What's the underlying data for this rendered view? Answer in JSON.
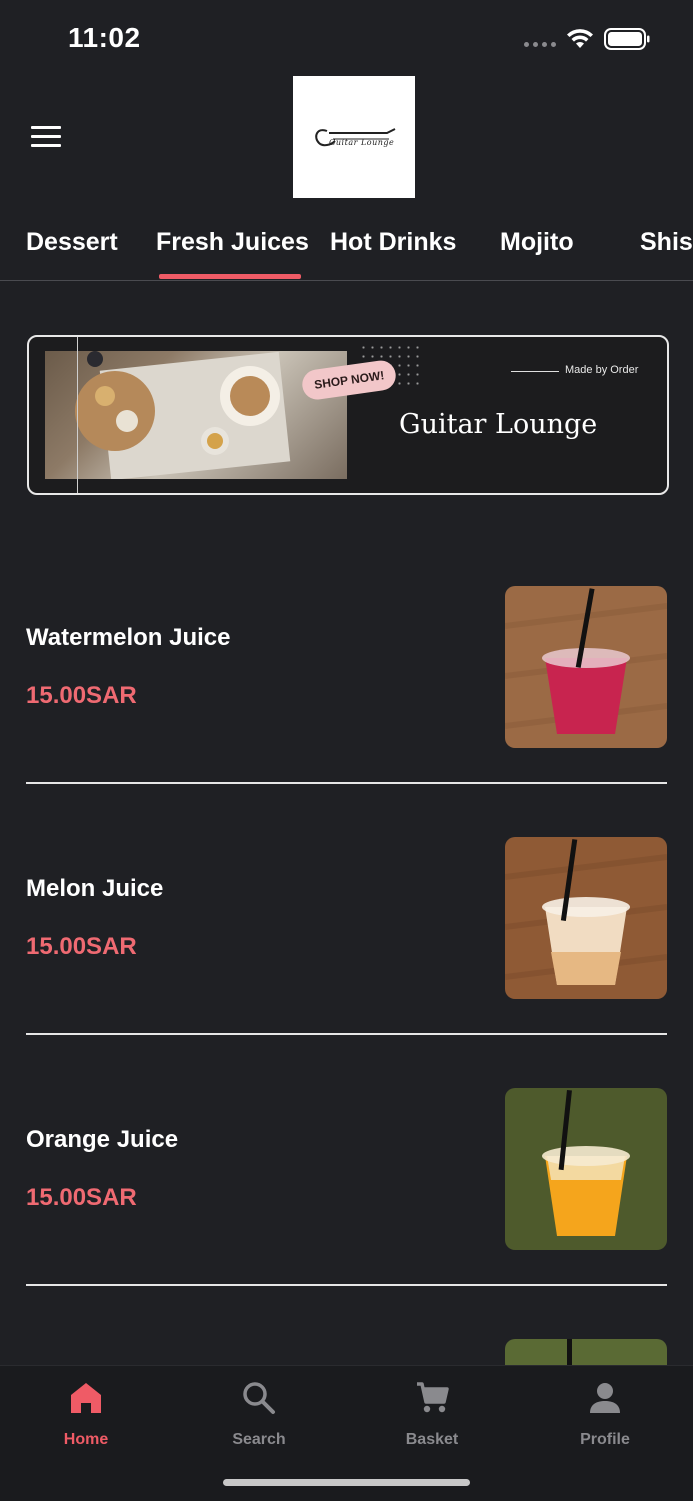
{
  "status_bar": {
    "time": "11:02"
  },
  "header": {
    "logo_text": "Guitar Lounge"
  },
  "tabs": [
    {
      "label": "Dessert"
    },
    {
      "label": "Fresh Juices",
      "active": true
    },
    {
      "label": "Hot Drinks"
    },
    {
      "label": "Mojito"
    },
    {
      "label": "Shisha"
    }
  ],
  "banner": {
    "pill": "SHOP NOW!",
    "tagline": "Made by Order",
    "title": "Guitar Lounge"
  },
  "products": [
    {
      "name": "Watermelon Juice",
      "price": "15.00SAR",
      "drink_color": "#c8244f"
    },
    {
      "name": "Melon Juice",
      "price": "15.00SAR",
      "drink_color": "#f1dcc2"
    },
    {
      "name": "Orange Juice",
      "price": "15.00SAR",
      "drink_color": "#f5a51c"
    }
  ],
  "bottom_nav": [
    {
      "label": "Home",
      "icon": "home-icon",
      "active": true
    },
    {
      "label": "Search",
      "icon": "search-icon"
    },
    {
      "label": "Basket",
      "icon": "cart-icon"
    },
    {
      "label": "Profile",
      "icon": "person-icon"
    }
  ],
  "colors": {
    "accent": "#ef5b66",
    "price": "#ef6a72",
    "background": "#1f2024",
    "inactive": "#8a8a8e"
  }
}
